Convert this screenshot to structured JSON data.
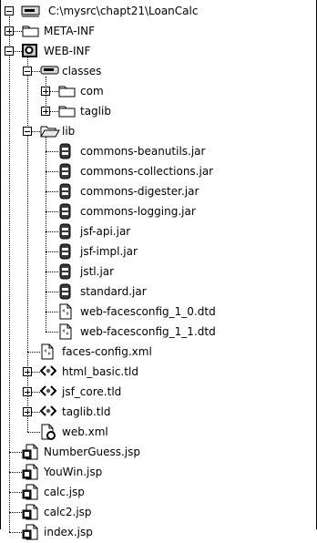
{
  "tree": {
    "root": {
      "label": "C:\\mysrc\\chapt21\\LoanCalc"
    },
    "items": [
      {
        "label": "META-INF",
        "icon": "folder-icon",
        "level": 1,
        "expander": "plus"
      },
      {
        "label": "WEB-INF",
        "icon": "web-inf-folder-icon",
        "level": 1,
        "expander": "minus"
      },
      {
        "label": "classes",
        "icon": "package-folder-icon",
        "level": 2,
        "expander": "minus"
      },
      {
        "label": "com",
        "icon": "folder-icon",
        "level": 3,
        "expander": "plus"
      },
      {
        "label": "taglib",
        "icon": "folder-icon",
        "level": 3,
        "expander": "plus"
      },
      {
        "label": "lib",
        "icon": "open-folder-icon",
        "level": 2,
        "expander": "minus"
      },
      {
        "label": "commons-beanutils.jar",
        "icon": "jar-icon",
        "level": 3
      },
      {
        "label": "commons-collections.jar",
        "icon": "jar-icon",
        "level": 3
      },
      {
        "label": "commons-digester.jar",
        "icon": "jar-icon",
        "level": 3
      },
      {
        "label": "commons-logging.jar",
        "icon": "jar-icon",
        "level": 3
      },
      {
        "label": "jsf-api.jar",
        "icon": "jar-icon",
        "level": 3
      },
      {
        "label": "jsf-impl.jar",
        "icon": "jar-icon",
        "level": 3
      },
      {
        "label": "jstl.jar",
        "icon": "jar-icon",
        "level": 3
      },
      {
        "label": "standard.jar",
        "icon": "jar-icon",
        "level": 3
      },
      {
        "label": "web-facesconfig_1_0.dtd",
        "icon": "dtd-file-icon",
        "level": 3
      },
      {
        "label": "web-facesconfig_1_1.dtd",
        "icon": "dtd-file-icon",
        "level": 3
      },
      {
        "label": "faces-config.xml",
        "icon": "xml-file-icon",
        "level": 2
      },
      {
        "label": "html_basic.tld",
        "icon": "tld-icon",
        "level": 2,
        "expander": "plus"
      },
      {
        "label": "jsf_core.tld",
        "icon": "tld-icon",
        "level": 2,
        "expander": "plus"
      },
      {
        "label": "taglib.tld",
        "icon": "tld-icon",
        "level": 2,
        "expander": "plus"
      },
      {
        "label": "web.xml",
        "icon": "web-xml-file-icon",
        "level": 2
      },
      {
        "label": "NumberGuess.jsp",
        "icon": "jsp-file-icon",
        "level": 1
      },
      {
        "label": "YouWin.jsp",
        "icon": "jsp-file-icon",
        "level": 1
      },
      {
        "label": "calc.jsp",
        "icon": "jsp-file-icon",
        "level": 1
      },
      {
        "label": "calc2.jsp",
        "icon": "jsp-file-icon",
        "level": 1
      },
      {
        "label": "index.jsp",
        "icon": "jsp-file-icon",
        "level": 1
      }
    ]
  }
}
